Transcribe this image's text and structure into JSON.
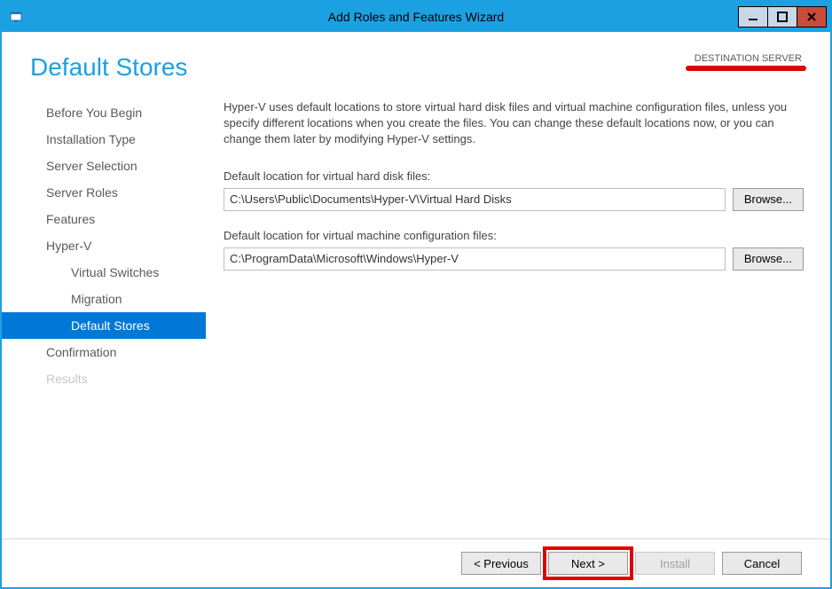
{
  "window": {
    "title": "Add Roles and Features Wizard"
  },
  "header": {
    "page_title": "Default Stores",
    "destination_label": "DESTINATION SERVER"
  },
  "sidebar": {
    "items": [
      {
        "label": "Before You Begin",
        "child": false,
        "selected": false,
        "disabled": false
      },
      {
        "label": "Installation Type",
        "child": false,
        "selected": false,
        "disabled": false
      },
      {
        "label": "Server Selection",
        "child": false,
        "selected": false,
        "disabled": false
      },
      {
        "label": "Server Roles",
        "child": false,
        "selected": false,
        "disabled": false
      },
      {
        "label": "Features",
        "child": false,
        "selected": false,
        "disabled": false
      },
      {
        "label": "Hyper-V",
        "child": false,
        "selected": false,
        "disabled": false
      },
      {
        "label": "Virtual Switches",
        "child": true,
        "selected": false,
        "disabled": false
      },
      {
        "label": "Migration",
        "child": true,
        "selected": false,
        "disabled": false
      },
      {
        "label": "Default Stores",
        "child": true,
        "selected": true,
        "disabled": false
      },
      {
        "label": "Confirmation",
        "child": false,
        "selected": false,
        "disabled": false
      },
      {
        "label": "Results",
        "child": false,
        "selected": false,
        "disabled": true
      }
    ]
  },
  "main": {
    "description": "Hyper-V uses default locations to store virtual hard disk files and virtual machine configuration files, unless you specify different locations when you create the files. You can change these default locations now, or you can change them later by modifying Hyper-V settings.",
    "vhd_label": "Default location for virtual hard disk files:",
    "vhd_path": "C:\\Users\\Public\\Documents\\Hyper-V\\Virtual Hard Disks",
    "vmconfig_label": "Default location for virtual machine configuration files:",
    "vmconfig_path": "C:\\ProgramData\\Microsoft\\Windows\\Hyper-V",
    "browse_label": "Browse..."
  },
  "footer": {
    "previous": "< Previous",
    "next": "Next >",
    "install": "Install",
    "cancel": "Cancel"
  }
}
